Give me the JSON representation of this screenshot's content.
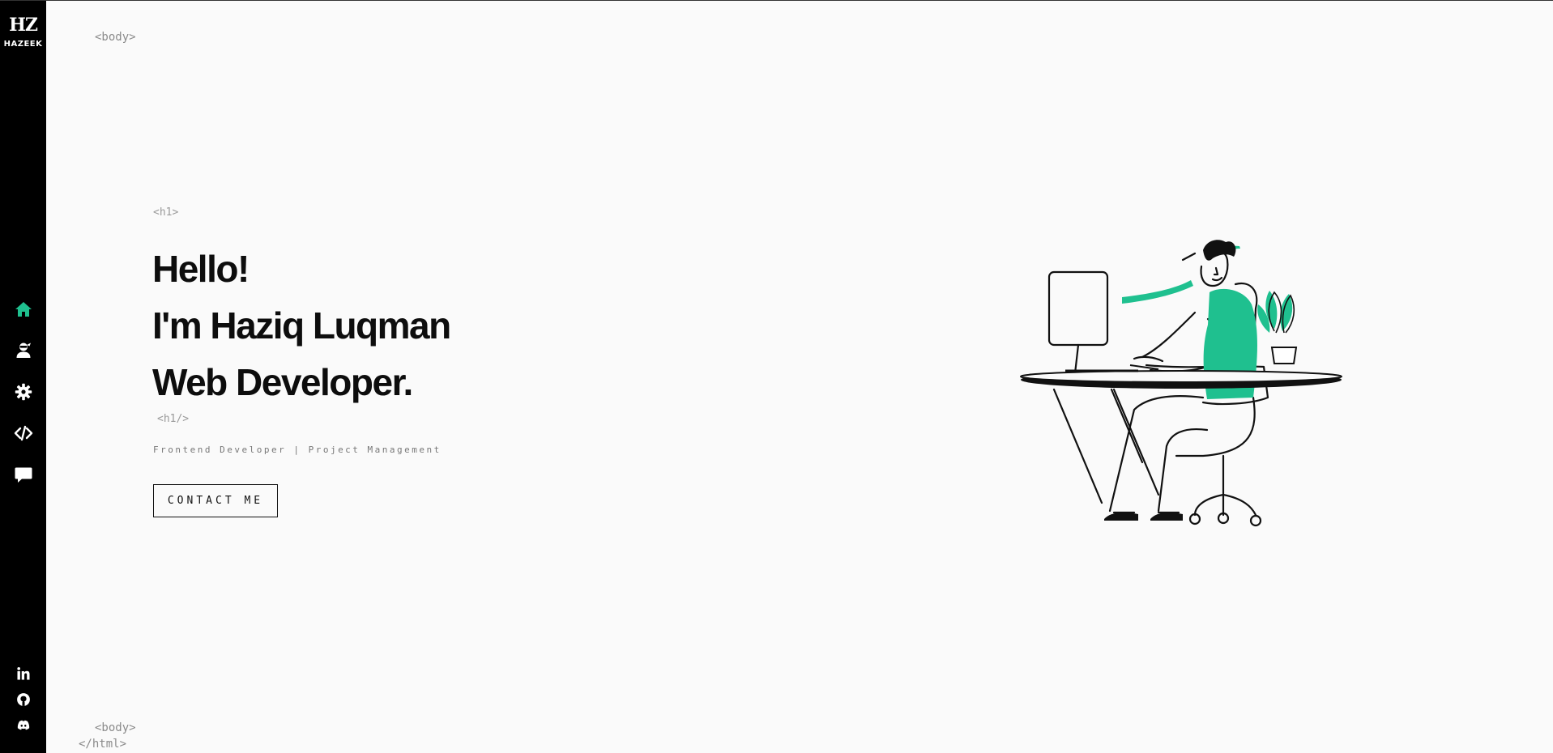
{
  "brand": {
    "mark": "HZ",
    "name": "HAZEEK"
  },
  "nav": {
    "accent_color": "#1fc08f",
    "items": [
      {
        "icon": "home-icon",
        "active": true
      },
      {
        "icon": "user-ninja-icon",
        "active": false
      },
      {
        "icon": "gear-icon",
        "active": false
      },
      {
        "icon": "code-icon",
        "active": false
      },
      {
        "icon": "chat-bubble-icon",
        "active": false
      }
    ]
  },
  "social": [
    {
      "icon": "linkedin-icon"
    },
    {
      "icon": "github-icon"
    },
    {
      "icon": "discord-icon"
    }
  ],
  "tags": {
    "body_open": "<body>",
    "h1_open": "<h1>",
    "h1_close": "<h1/>",
    "body_close": "<body>",
    "html_close": "</html>"
  },
  "hero": {
    "line1": "Hello!",
    "line2": "I'm Haziq Luqman",
    "line3": "Web Developer.",
    "subtitle": "Frontend Developer | Project Management",
    "cta_label": "CONTACT ME"
  },
  "illustration": {
    "subject": "developer-at-desk-illustration",
    "accent_color": "#1fc08f"
  }
}
